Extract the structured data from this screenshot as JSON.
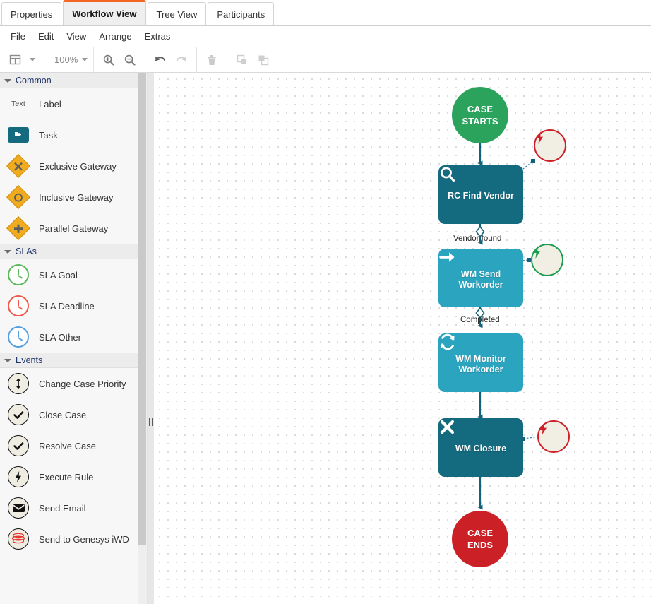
{
  "tabs": [
    {
      "label": "Properties",
      "active": false
    },
    {
      "label": "Workflow View",
      "active": true
    },
    {
      "label": "Tree View",
      "active": false
    },
    {
      "label": "Participants",
      "active": false
    }
  ],
  "menu": [
    "File",
    "Edit",
    "View",
    "Arrange",
    "Extras"
  ],
  "toolbar": {
    "layout_label": "layout-icon",
    "zoom_level": "100%",
    "zoom_in": "zoom-in-icon",
    "zoom_out": "zoom-out-icon",
    "undo": "undo-icon",
    "redo": "redo-icon",
    "delete": "trash-icon",
    "to_front": "bring-to-front-icon",
    "to_back": "send-to-back-icon"
  },
  "palette": {
    "sections": [
      {
        "title": "Common",
        "items": [
          {
            "label": "Label",
            "icon": "text-icon"
          },
          {
            "label": "Task",
            "icon": "task-icon"
          },
          {
            "label": "Exclusive Gateway",
            "icon": "exclusive-gateway-icon"
          },
          {
            "label": "Inclusive Gateway",
            "icon": "inclusive-gateway-icon"
          },
          {
            "label": "Parallel Gateway",
            "icon": "parallel-gateway-icon"
          }
        ]
      },
      {
        "title": "SLAs",
        "items": [
          {
            "label": "SLA Goal",
            "icon": "clock-icon",
            "color": "#5cb85c"
          },
          {
            "label": "SLA Deadline",
            "icon": "clock-icon",
            "color": "#f0594c"
          },
          {
            "label": "SLA Other",
            "icon": "clock-icon",
            "color": "#54a0e0"
          }
        ]
      },
      {
        "title": "Events",
        "items": [
          {
            "label": "Change Case Priority",
            "icon": "priority-arrows-icon"
          },
          {
            "label": "Close Case",
            "icon": "check-icon"
          },
          {
            "label": "Resolve Case",
            "icon": "check-icon"
          },
          {
            "label": "Execute Rule",
            "icon": "lightning-icon"
          },
          {
            "label": "Send Email",
            "icon": "envelope-icon"
          },
          {
            "label": "Send to Genesys iWD",
            "icon": "genesys-iwd-icon"
          }
        ]
      }
    ]
  },
  "diagram": {
    "colors": {
      "start": "#2ba35c",
      "end": "#cb2026",
      "task_dark": "#146a7e",
      "task_light": "#2ba4c0",
      "connector": "#14627a",
      "badge_red": "#cf2027",
      "badge_green": "#1d9d4f"
    },
    "nodes": [
      {
        "id": "start",
        "type": "start-event",
        "label": "CASE\nSTARTS",
        "line1": "CASE",
        "line2": "STARTS"
      },
      {
        "id": "rc-find-vendor",
        "type": "task",
        "label": "RC Find Vendor",
        "icon": "magnifier-icon",
        "fill": "#146a7e"
      },
      {
        "id": "wm-send-workorder",
        "type": "task",
        "label": "WM Send Workorder",
        "icon": "arrow-right-icon",
        "fill": "#2ba4c0"
      },
      {
        "id": "wm-monitor-workorder",
        "type": "task",
        "label": "WM Monitor Workorder",
        "line1": "WM Monitor",
        "line2": "Workorder",
        "icon": "refresh-icon",
        "fill": "#2ba4c0"
      },
      {
        "id": "wm-closure",
        "type": "task",
        "label": "WM Closure",
        "icon": "x-icon",
        "fill": "#146a7e"
      },
      {
        "id": "end",
        "type": "end-event",
        "label": "CASE\nENDS",
        "line1": "CASE",
        "line2": "ENDS"
      }
    ],
    "edge_labels": [
      "Vendor found",
      "Completed"
    ],
    "badges": [
      {
        "id": "badge-rc-find-vendor",
        "icon": "lightning-icon",
        "color": "#cf2027"
      },
      {
        "id": "badge-wm-send-workorder",
        "icon": "lightning-icon",
        "color": "#1d9d4f"
      },
      {
        "id": "badge-wm-closure",
        "icon": "lightning-icon",
        "color": "#cf2027"
      }
    ]
  }
}
